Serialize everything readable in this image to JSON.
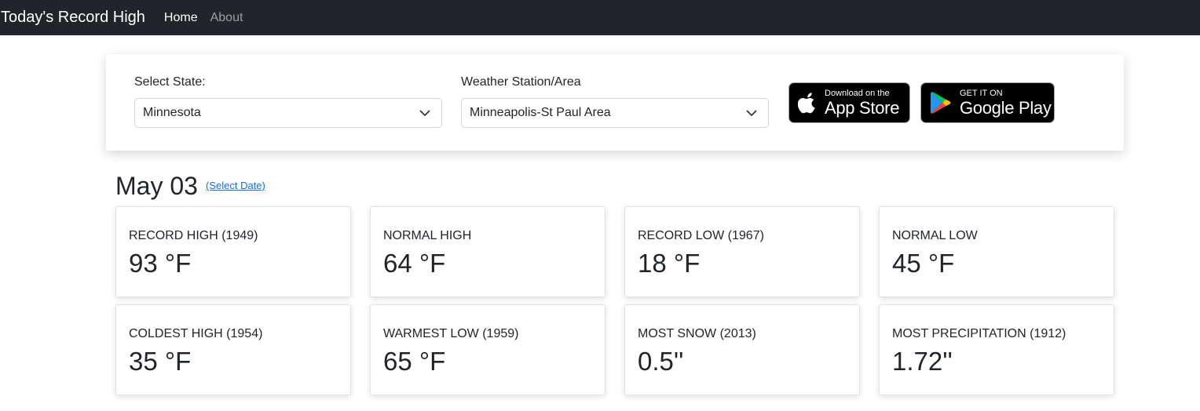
{
  "navbar": {
    "brand": "Today's Record High",
    "links": [
      {
        "label": "Home",
        "active": true
      },
      {
        "label": "About",
        "active": false
      }
    ]
  },
  "selectors": {
    "state": {
      "label": "Select State:",
      "value": "Minnesota"
    },
    "station": {
      "label": "Weather Station/Area",
      "value": "Minneapolis-St Paul Area"
    }
  },
  "badges": {
    "app_store": {
      "small": "Download on the",
      "big": "App Store",
      "icon": "apple-icon"
    },
    "google_play": {
      "small": "GET IT ON",
      "big": "Google Play",
      "icon": "google-play-icon"
    }
  },
  "date": {
    "title": "May 03",
    "select_link": "(Select Date)"
  },
  "stats": [
    {
      "label": "RECORD HIGH (1949)",
      "value": "93 °F"
    },
    {
      "label": "NORMAL HIGH",
      "value": "64 °F"
    },
    {
      "label": "RECORD LOW (1967)",
      "value": "18 °F"
    },
    {
      "label": "NORMAL LOW",
      "value": "45 °F"
    },
    {
      "label": "COLDEST HIGH (1954)",
      "value": "35 °F"
    },
    {
      "label": "WARMEST LOW (1959)",
      "value": "65 °F"
    },
    {
      "label": "MOST SNOW (2013)",
      "value": "0.5''"
    },
    {
      "label": "MOST PRECIPITATION (1912)",
      "value": "1.72''"
    }
  ],
  "colors": {
    "navbar_bg": "#212529",
    "link": "#0d6efd",
    "text": "#212529"
  }
}
